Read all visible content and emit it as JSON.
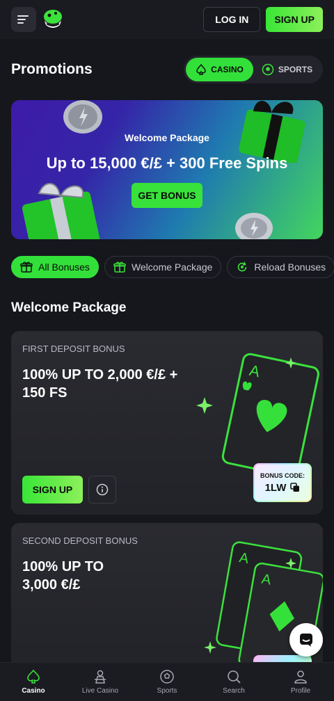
{
  "header": {
    "login_label": "LOG IN",
    "signup_label": "SIGN UP"
  },
  "page": {
    "title": "Promotions",
    "toggle": [
      {
        "label": "CASINO",
        "icon": "spade-icon",
        "active": true
      },
      {
        "label": "SPORTS",
        "icon": "soccer-ball-icon",
        "active": false
      }
    ]
  },
  "banner": {
    "subtitle": "Welcome Package",
    "title": "Up to 15,000 €/£ + 300 Free Spins",
    "button_label": "GET BONUS"
  },
  "filters": [
    {
      "label": "All Bonuses",
      "icon": "gift-icon",
      "active": true
    },
    {
      "label": "Welcome Package",
      "icon": "gift-box-icon",
      "active": false
    },
    {
      "label": "Reload Bonuses",
      "icon": "reload-icon",
      "active": false
    }
  ],
  "section": {
    "title": "Welcome Package"
  },
  "cards": [
    {
      "label": "FIRST DEPOSIT BONUS",
      "title": "100% UP TO 2,000 €/£ + 150 FS",
      "signup_label": "SIGN UP",
      "bonus_code_label": "BONUS CODE:",
      "bonus_code": "1LW"
    },
    {
      "label": "SECOND DEPOSIT BONUS",
      "title": "100% UP TO 3,000 €/£"
    }
  ],
  "bottom_nav": [
    {
      "label": "Casino",
      "icon": "spade-icon",
      "active": true
    },
    {
      "label": "Live Casino",
      "icon": "dealer-icon",
      "active": false
    },
    {
      "label": "Sports",
      "icon": "soccer-ball-icon",
      "active": false
    },
    {
      "label": "Search",
      "icon": "search-icon",
      "active": false
    },
    {
      "label": "Profile",
      "icon": "profile-icon",
      "active": false
    }
  ],
  "colors": {
    "accent": "#33e03a",
    "background": "#16171d",
    "card": "#26272d"
  }
}
